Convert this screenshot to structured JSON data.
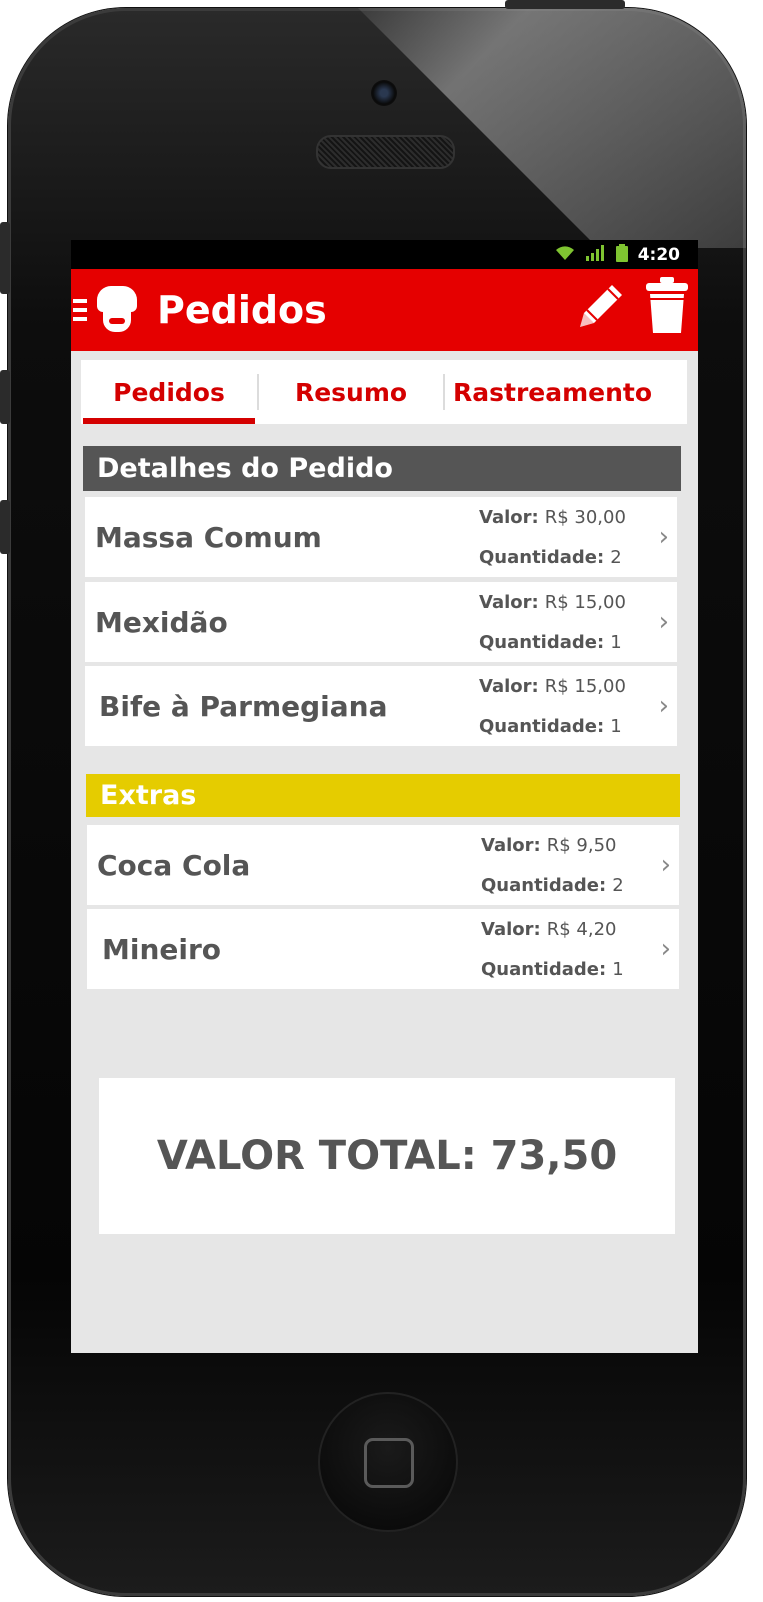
{
  "status_bar": {
    "time": "4:20"
  },
  "app_bar": {
    "title": "Pedidos",
    "icons": [
      "menu-icon",
      "chef-logo-icon",
      "edit-pencil-icon",
      "trash-icon"
    ]
  },
  "tabs": [
    {
      "label": "Pedidos",
      "active": true
    },
    {
      "label": "Resumo",
      "active": false
    },
    {
      "label": "Rastreamento",
      "active": false
    }
  ],
  "order_section": {
    "title": "Detalhes do Pedido",
    "color": "#555555",
    "items": [
      {
        "name": "Massa Comum",
        "value_label": "Valor:",
        "value": "R$ 30,00",
        "qty_label": "Quantidade:",
        "qty": "2"
      },
      {
        "name": "Mexidão",
        "value_label": "Valor:",
        "value": "R$ 15,00",
        "qty_label": "Quantidade:",
        "qty": "1"
      },
      {
        "name": "Bife à Parmegiana",
        "value_label": "Valor:",
        "value": "R$ 15,00",
        "qty_label": "Quantidade:",
        "qty": "1"
      }
    ]
  },
  "extras_section": {
    "title": "Extras",
    "color": "#e5cc00",
    "items": [
      {
        "name": "Coca Cola",
        "value_label": "Valor:",
        "value": "R$ 9,50",
        "qty_label": "Quantidade:",
        "qty": "2"
      },
      {
        "name": "Mineiro",
        "value_label": "Valor:",
        "value": "R$ 4,20",
        "qty_label": "Quantidade:",
        "qty": "1"
      }
    ]
  },
  "total": {
    "text": "VALOR TOTAL: 73,50"
  },
  "colors": {
    "accent": "#e50000",
    "tab_text": "#d40000",
    "background": "#e6e6e6"
  }
}
